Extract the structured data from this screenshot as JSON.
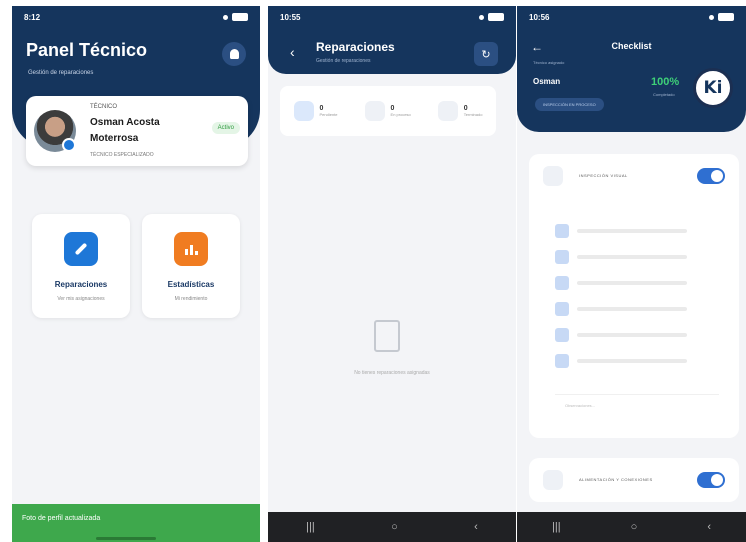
{
  "screen1": {
    "status_time": "8:12",
    "title": "Panel Técnico",
    "subtitle": "Gestión de reparaciones",
    "profile": {
      "role": "TÉCNICO",
      "name": "Osman Acosta Moterrosa",
      "status": "Activo",
      "tech_label": "TÉCNICO ESPECIALIZADO"
    },
    "tiles": [
      {
        "label": "Reparaciones",
        "sub": "Ver mis asignaciones",
        "icon": "wrench-icon"
      },
      {
        "label": "Estadísticas",
        "sub": "Mi rendimiento",
        "icon": "bar-chart-icon"
      }
    ],
    "toast": "Foto de perfil actualizada"
  },
  "screen2": {
    "status_time": "10:55",
    "title": "Reparaciones",
    "subtitle": "Gestión de reparaciones",
    "stats": [
      {
        "value": "0",
        "label": "Pendiente"
      },
      {
        "value": "0",
        "label": "En proceso"
      },
      {
        "value": "0",
        "label": "Terminado"
      }
    ],
    "empty_text": "No tienes reparaciones asignadas",
    "nav": [
      "|||",
      "○",
      "‹"
    ]
  },
  "screen3": {
    "status_time": "10:56",
    "title": "Checklist",
    "tech_label": "Técnico asignado",
    "tech_name": "Osman",
    "progress": "100%",
    "progress_label": "Completado",
    "chip": "INSPECCIÓN EN PROCESO",
    "logo_text": "Ki",
    "section1_title": "INSPECCIÓN VISUAL",
    "section2_title": "ALIMENTACIÓN Y CONEXIONES",
    "check_count": 6,
    "observations_placeholder": "Observaciones...",
    "nav": [
      "|||",
      "○",
      "‹"
    ]
  }
}
